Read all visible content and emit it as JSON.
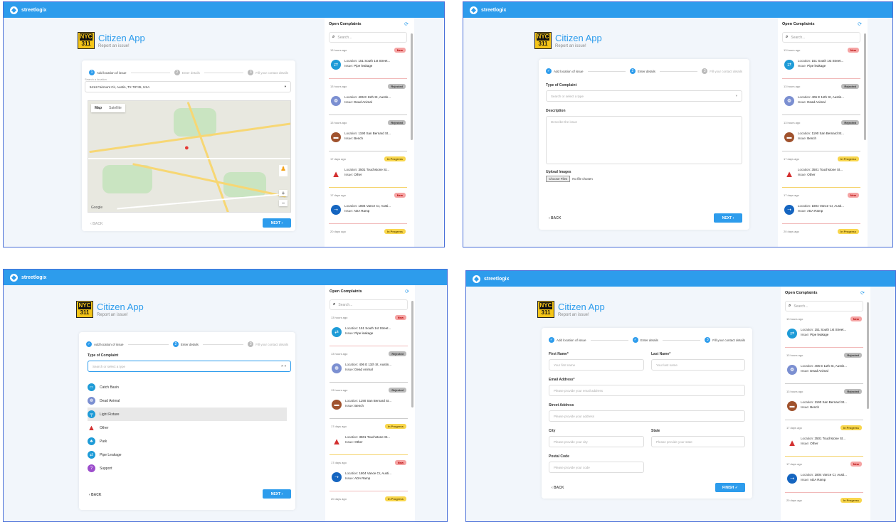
{
  "brand": "streetlogix",
  "header": {
    "logo_top": "NYC",
    "logo_bottom": "311",
    "title": "Citizen App",
    "subtitle": "Report an issue!"
  },
  "steps": {
    "s1": "Add location of issue",
    "s2": "Enter details",
    "s3": "Fill your contact details"
  },
  "buttons": {
    "next": "NEXT  ›",
    "back": "‹  BACK",
    "finish": "FINISH  ✓",
    "back_disabled": "‹  BACK"
  },
  "panel1": {
    "search_label": "Search a location",
    "address": "5414 Fairmont Cir, Austin, TX 78745, USA",
    "map_tab": "Map",
    "satellite_tab": "Satellite",
    "google": "Google"
  },
  "panel2": {
    "type_label": "Type of Complaint",
    "type_placeholder": "Search or select a type",
    "desc_label": "Description",
    "desc_placeholder": "Describe the issue",
    "upload_label": "Upload Images",
    "file_btn": "Choose Files",
    "file_none": "No file chosen"
  },
  "panel3": {
    "type_label": "Type of Complaint",
    "type_placeholder": "Search or select a type",
    "options": [
      "Catch Basin",
      "Dead Animal",
      "Light Fixture",
      "Other",
      "Park",
      "Pipe Leakage",
      "Support"
    ]
  },
  "panel4": {
    "first_name": "First Name*",
    "first_ph": "Your first name",
    "last_name": "Last Name*",
    "last_ph": "Your last name",
    "email": "Email Address*",
    "email_ph": "Please provide your email address",
    "street": "Street Address",
    "street_ph": "Please provide your address",
    "city": "City",
    "city_ph": "Please provide your city",
    "state": "State",
    "state_ph": "Please provide your state",
    "postal": "Postal Code",
    "postal_ph": "Please provide your code"
  },
  "sidebar": {
    "title": "Open Complaints",
    "search": "Search...",
    "loc_label": "Location:",
    "issue_label": "Issue:",
    "items": [
      {
        "time": "13 hours ago",
        "status": "New",
        "location": "151 South 1st Street...",
        "issue": "Pipe leakage"
      },
      {
        "time": "13 hours ago",
        "status": "Rejected",
        "location": "406 E 11th St, Austin...",
        "issue": "Dead Animal"
      },
      {
        "time": "13 hours ago",
        "status": "Rejected",
        "location": "1190 San Bernard St...",
        "issue": "Bench"
      },
      {
        "time": "17 days ago",
        "status": "In Progress",
        "location": "3501 Touchstone St...",
        "issue": "Other"
      },
      {
        "time": "17 days ago",
        "status": "New",
        "location": "1804 Vance Cr, Austi...",
        "issue": "ADA Ramp"
      },
      {
        "time": "20 days ago",
        "status": "In Progress",
        "location": "",
        "issue": ""
      }
    ]
  }
}
